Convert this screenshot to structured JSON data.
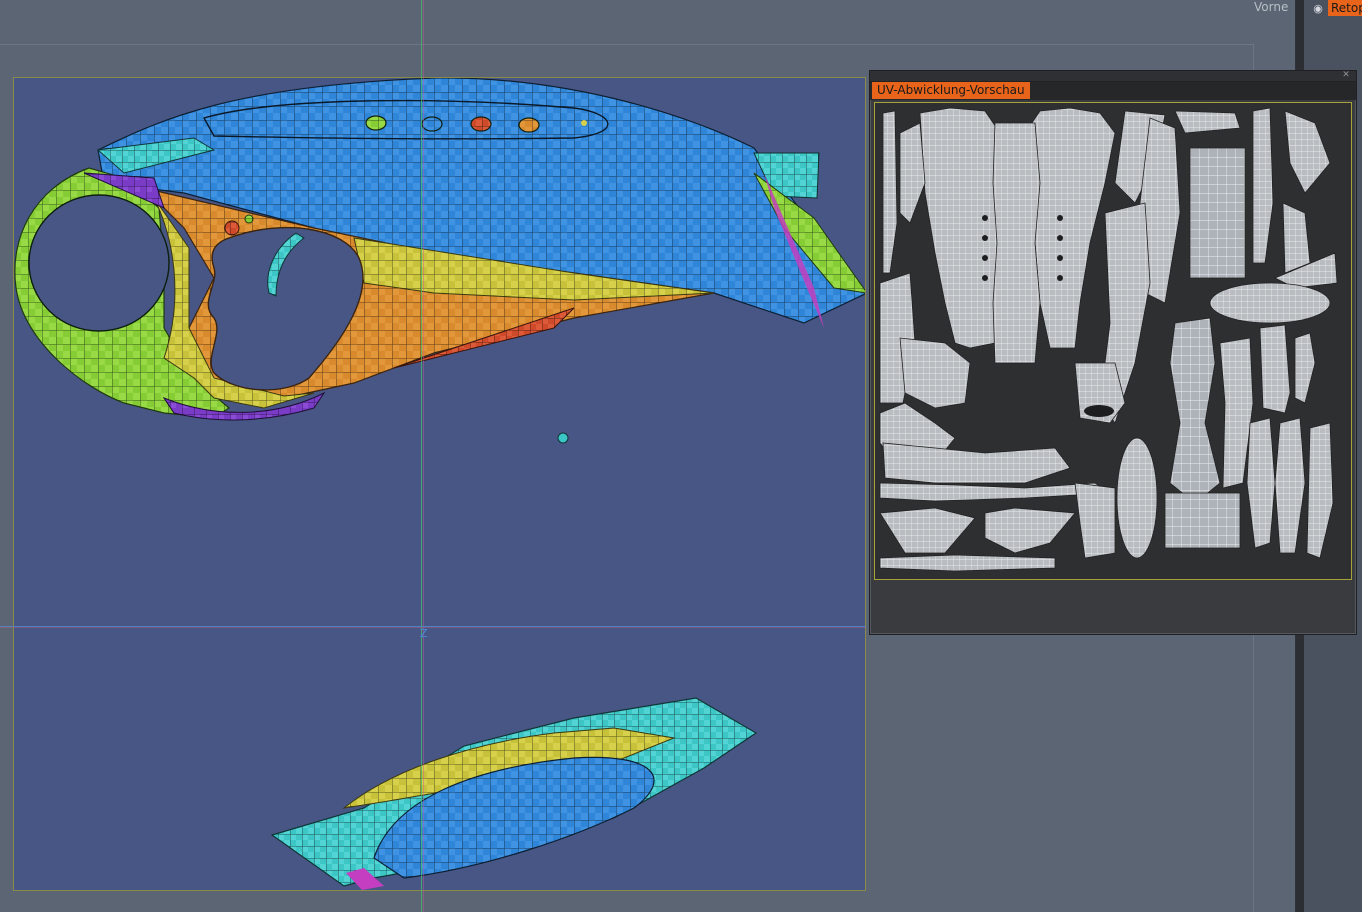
{
  "viewport": {
    "view_label": "Vorne",
    "axis_label": "Z"
  },
  "side_panel": {
    "tab_label": "Retop",
    "visibility_icon": "eye-icon"
  },
  "uv_preview": {
    "tab_label": "UV-Abwicklung-Vorschau",
    "close_icon": "close-icon"
  },
  "colors": {
    "viewport_bg": "#5b6573",
    "render_bg": "#485685",
    "accent_orange": "#e8641a",
    "uv_bg": "#2e2f31",
    "mesh_blue": "#2f86d9",
    "mesh_orange": "#d88a2c",
    "mesh_green": "#8fd13a",
    "mesh_yellow": "#c9c43a",
    "mesh_cyan": "#3cc6c6",
    "mesh_purple": "#7a3bc7",
    "mesh_red": "#cf4a2a"
  }
}
